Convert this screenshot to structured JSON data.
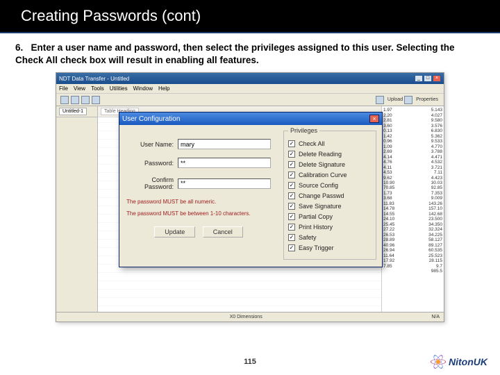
{
  "slide": {
    "title": "Creating Passwords (cont)",
    "step_num": "6.",
    "instruction": "Enter a user name and password, then select the privileges assigned to this user. Selecting the Check All check box will result in enabling all features.",
    "page_number": "115",
    "brand": "NitonUK"
  },
  "app": {
    "title": "NDT Data Transfer - Untitled",
    "menus": [
      "File",
      "View",
      "Tools",
      "Utilities",
      "Window",
      "Help"
    ],
    "toolbar_labels": {
      "left": "Upload",
      "right": "Properties"
    },
    "tabs": {
      "left": "Untitled-1",
      "sheet": "Table Heading"
    },
    "status": {
      "left": "",
      "mid": "X0 Dimensions",
      "right": "N/A"
    }
  },
  "dialog": {
    "title": "User Configuration",
    "fields": {
      "user_label": "User Name:",
      "user_value": "mary",
      "pass_label": "Password:",
      "pass_value": "**",
      "conf_label": "Confirm Password:",
      "conf_value": "**"
    },
    "hints": {
      "h1": "The password MUST be all numeric.",
      "h2": "The password MUST be between 1-10 characters."
    },
    "buttons": {
      "update": "Update",
      "cancel": "Cancel"
    },
    "privileges_title": "Privileges",
    "privileges": [
      "Check All",
      "Delete Reading",
      "Delete Signature",
      "Calibration Curve",
      "Source Config",
      "Change Passwd",
      "Save Signature",
      "Partial Copy",
      "Print History",
      "Safety",
      "Easy Trigger"
    ]
  },
  "data_rows": [
    [
      "1.97",
      "5.143"
    ],
    [
      "2.20",
      "4.027"
    ],
    [
      "2.81",
      "9.580"
    ],
    [
      "3.60",
      "3.576"
    ],
    [
      "0.13",
      "6.830"
    ],
    [
      "1.42",
      "5.362"
    ],
    [
      "0.96",
      "9.533"
    ],
    [
      "1.09",
      "4.770"
    ],
    [
      "2.69",
      "3.788"
    ],
    [
      "4.14",
      "4.471"
    ],
    [
      "4.76",
      "4.532"
    ],
    [
      "4.11",
      "3.721"
    ],
    [
      "4.53",
      "7.11"
    ],
    [
      "9.62",
      "4.423"
    ],
    [
      "10.90",
      "30.03"
    ],
    [
      "70.85",
      "92.85"
    ],
    [
      "1.73",
      "7.353"
    ],
    [
      "3.68",
      "9.009"
    ],
    [
      "11.83",
      "143.26"
    ],
    [
      "14.78",
      "157.10"
    ],
    [
      "14.55",
      "142.68"
    ],
    [
      "24.10",
      "23.500"
    ],
    [
      "25.45",
      "34.350"
    ],
    [
      "27.22",
      "32.324"
    ],
    [
      "26.53",
      "34.225"
    ],
    [
      "28.89",
      "58.127"
    ],
    [
      "40.96",
      "89.127"
    ],
    [
      "26.94",
      "60.535"
    ],
    [
      "11.64",
      "25.523"
    ],
    [
      "17.92",
      "28.115"
    ],
    [
      "7.85",
      "9.7"
    ],
    [
      "",
      "985.5"
    ]
  ]
}
